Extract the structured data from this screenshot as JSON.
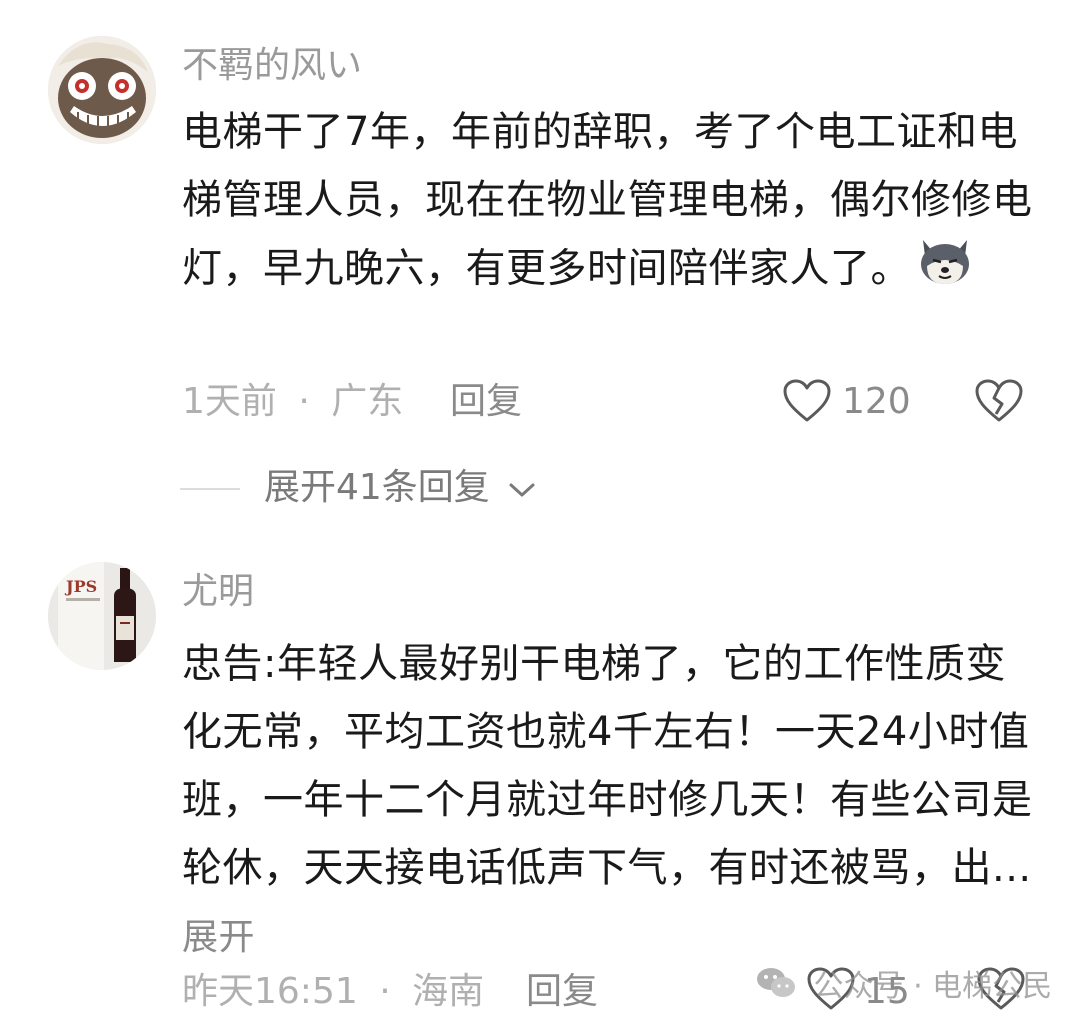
{
  "comments": [
    {
      "username": "不羁的风い",
      "text": "电梯干了7年，年前的辞职，考了个电工证和电梯管理人员，现在在物业管理电梯，偶尔修修电灯，早九晚六，有更多时间陪伴家人了。",
      "emoji_icon": "husky-dog-emoji-icon",
      "time": "1天前",
      "location": "广东",
      "reply_label": "回复",
      "like_count": "120",
      "expand_replies_label": "展开41条回复"
    },
    {
      "username": "尤明",
      "text": "忠告:年轻人最好别干电梯了，它的工作性质变化无常，平均工资也就4千左右！一天24小时值班，一年十二个月就过年时修几天！有些公司是轮休，天天接电话低声下气，有时还被骂，出...",
      "expand_label": "展开",
      "time": "昨天16:51",
      "location": "海南",
      "reply_label": "回复",
      "like_count": "15"
    }
  ],
  "watermark": {
    "text": "公众号 · 电梯公民",
    "icon": "wechat-icon"
  },
  "separator": "·",
  "colors": {
    "text_primary": "#1a1a1a",
    "text_secondary": "#9a9a9a",
    "background": "#ffffff"
  }
}
